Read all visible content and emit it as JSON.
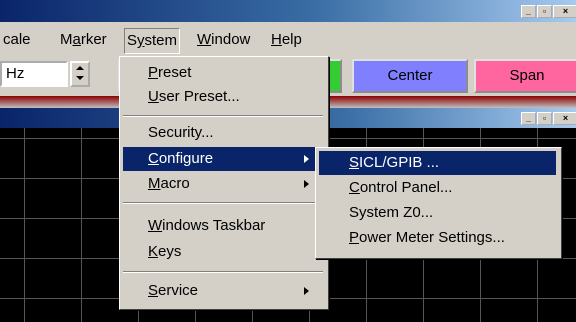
{
  "menubar": {
    "items": [
      {
        "label": "cale"
      },
      {
        "label": "Marker"
      },
      {
        "label": "System"
      },
      {
        "label": "Window"
      },
      {
        "label": "Help"
      }
    ]
  },
  "toolbar": {
    "freq_unit": "Hz",
    "softkeys": [
      {
        "label": "",
        "color": "#ffff00"
      },
      {
        "label": "",
        "color": "#33cc33"
      },
      {
        "label": "Center",
        "color": "#8080ff"
      },
      {
        "label": "Span",
        "color": "#ff66a0"
      }
    ]
  },
  "system_menu": {
    "items": [
      {
        "label": "Preset"
      },
      {
        "label": "User Preset..."
      },
      {
        "label": "Security..."
      },
      {
        "label": "Configure",
        "submenu": true,
        "highlighted": true
      },
      {
        "label": "Macro",
        "submenu": true
      },
      {
        "label": "Windows Taskbar"
      },
      {
        "label": "Keys"
      },
      {
        "label": "Service",
        "submenu": true
      }
    ]
  },
  "configure_submenu": {
    "items": [
      {
        "label": "SICL/GPIB ...",
        "highlighted": true
      },
      {
        "label": "Control Panel..."
      },
      {
        "label": "System Z0..."
      },
      {
        "label": "Power Meter Settings..."
      }
    ]
  },
  "icons": [
    "minimize-icon",
    "maximize-icon",
    "close-icon",
    "spin-up-icon",
    "spin-down-icon",
    "submenu-arrow-icon"
  ]
}
